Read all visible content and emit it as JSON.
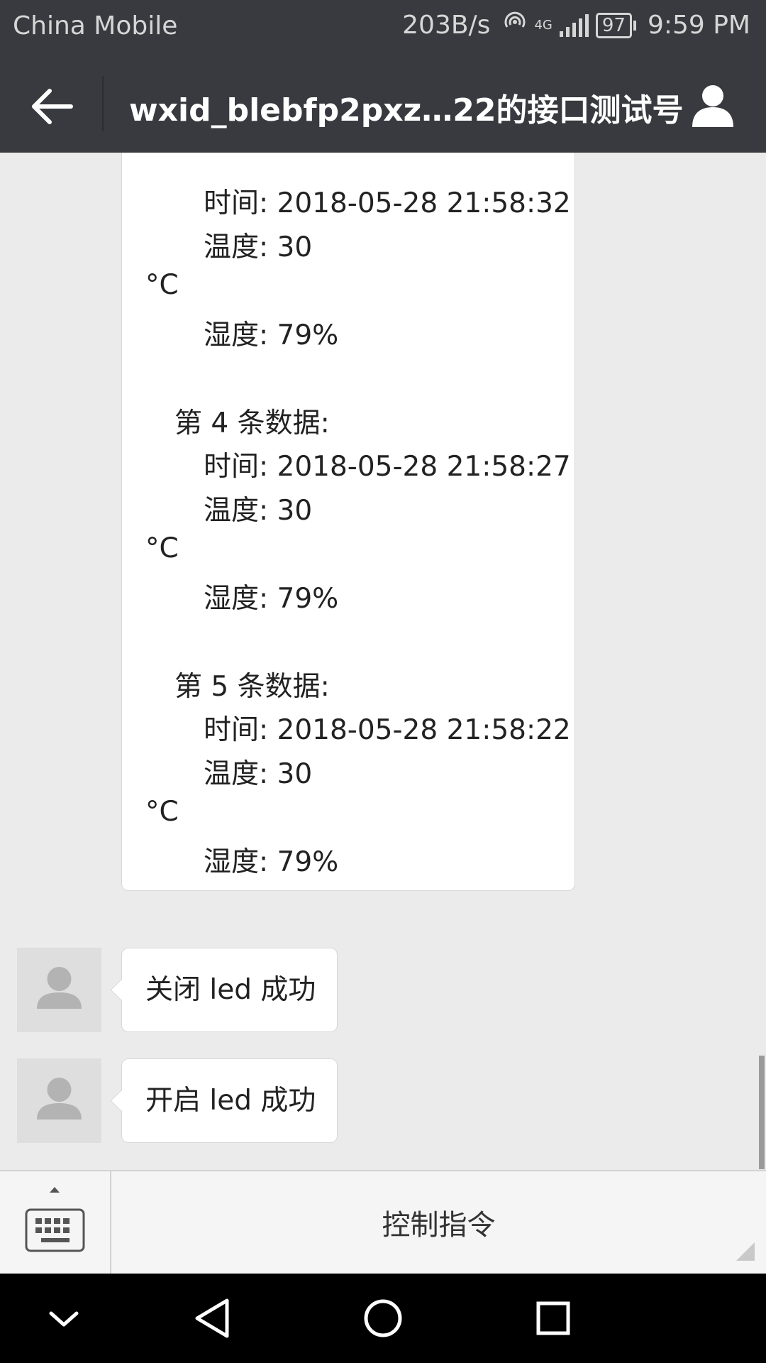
{
  "status_bar": {
    "carrier": "China Mobile",
    "net_speed": "203B/s",
    "net_type": "4G",
    "battery": "97",
    "time": "9:59 PM"
  },
  "header": {
    "title": "wxid_blebfp2pxz…22的接口测试号"
  },
  "messages": {
    "big_bubble_lines": [
      "时间: 2018-05-28 21:58:32",
      "温度: 30",
      "°C",
      "湿度: 79%",
      "第 4 条数据:",
      "时间: 2018-05-28 21:58:27",
      "温度: 30",
      "°C",
      "湿度: 79%",
      "第 5 条数据:",
      "时间: 2018-05-28 21:58:22",
      "温度: 30",
      "°C",
      "湿度: 79%"
    ],
    "bubble_1": "关闭 led 成功",
    "bubble_2": "开启 led 成功"
  },
  "menu": {
    "item_label": "控制指令"
  },
  "colors": {
    "bar_bg": "#393a3f",
    "chat_bg": "#ebebeb",
    "bubble_bg": "#ffffff"
  },
  "icons": {
    "back": "arrow-left-icon",
    "profile": "person-icon",
    "keyboard": "keyboard-icon",
    "nav_back": "triangle-back-icon",
    "nav_home": "circle-home-icon",
    "nav_recent": "square-recent-icon"
  }
}
